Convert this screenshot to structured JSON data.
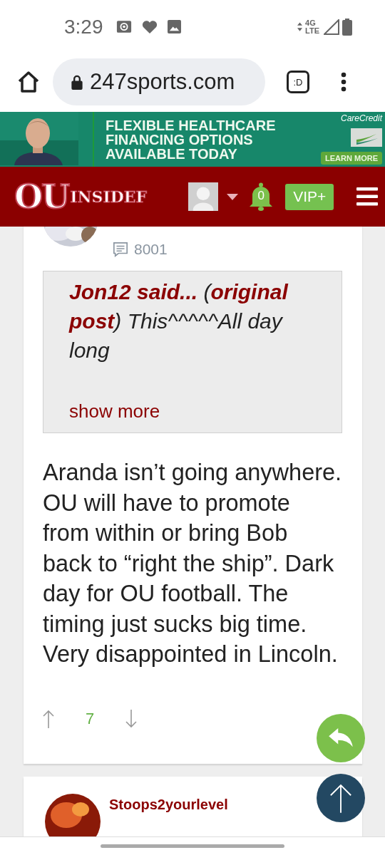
{
  "status_bar": {
    "time": "3:29",
    "network_top": "4G",
    "network_bottom": "LTE"
  },
  "browser": {
    "url": "247sports.com",
    "tab_button": ":D"
  },
  "ad": {
    "lines": [
      "FLEXIBLE HEALTHCARE",
      "FINANCING OPTIONS",
      "AVAILABLE TODAY"
    ],
    "brand": "CareCredit",
    "button": "LEARN MORE"
  },
  "site_header": {
    "logo_big": "OU",
    "logo_small": "INSIDEF",
    "notifications": "0",
    "vip": "VIP+"
  },
  "post": {
    "comment_count": "8001",
    "quote": {
      "text": "**Jon12 said...** (**original post**) This^^^^^All day long",
      "link": "show more"
    },
    "body": "Aranda isn’t going anywhere. OU will have to promote from within or bring Bob back to “right the ship”. Dark day for OU football. The timing just sucks big time. Very disappointed in Lincoln.",
    "votes": "7"
  },
  "next_post": {
    "author": "Stoops2yourlevel"
  }
}
